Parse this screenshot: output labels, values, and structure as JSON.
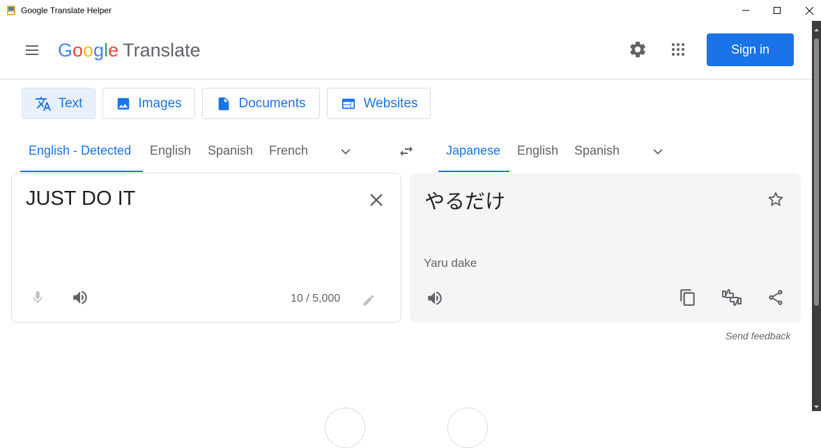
{
  "window": {
    "title": "Google Translate Helper",
    "minimize_icon": "minimize-icon",
    "maximize_icon": "maximize-icon",
    "close_icon": "close-icon"
  },
  "header": {
    "logo_letters": [
      "G",
      "o",
      "o",
      "g",
      "l",
      "e"
    ],
    "logo_word": "Translate",
    "sign_in_label": "Sign in",
    "menu_icon": "hamburger-menu-icon",
    "settings_icon": "gear-icon",
    "apps_icon": "apps-grid-icon",
    "brand_color": "#1a73e8"
  },
  "modes": [
    {
      "label": "Text",
      "icon": "translate-icon",
      "active": true
    },
    {
      "label": "Images",
      "icon": "image-icon",
      "active": false
    },
    {
      "label": "Documents",
      "icon": "document-icon",
      "active": false
    },
    {
      "label": "Websites",
      "icon": "website-icon",
      "active": false
    }
  ],
  "source_languages": [
    "English - Detected",
    "English",
    "Spanish",
    "French"
  ],
  "target_languages": [
    "Japanese",
    "English",
    "Spanish"
  ],
  "source": {
    "text": "JUST DO IT",
    "char_count": "10 / 5,000"
  },
  "target": {
    "text": "やるだけ",
    "romanization": "Yaru dake"
  },
  "footer": {
    "send_feedback": "Send feedback"
  }
}
